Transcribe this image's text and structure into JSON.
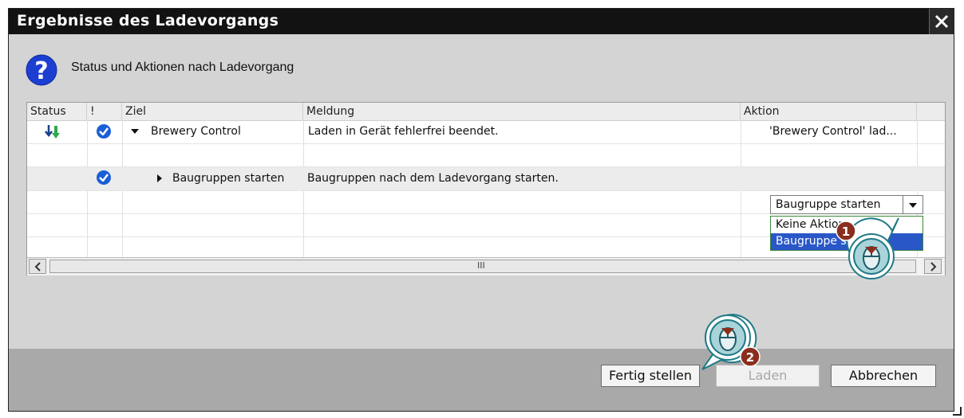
{
  "dialog": {
    "title": "Ergebnisse des Ladevorgangs",
    "header_text": "Status und Aktionen nach Ladevorgang"
  },
  "table": {
    "columns": [
      "Status",
      "!",
      "Ziel",
      "Meldung",
      "Aktion"
    ],
    "rows": [
      {
        "status_icon": "download-arrow-icon",
        "check_icon": "check-circle-icon",
        "expand": "expanded",
        "ziel": "Brewery Control",
        "meldung": "Laden in Gerät fehlerfrei beendet.",
        "aktion": "'Brewery Control' lad..."
      },
      {
        "check_icon": "check-circle-icon",
        "expand": "collapsed",
        "ziel": "Baugruppen starten",
        "meldung": "Baugruppen nach dem Ladevorgang starten.",
        "aktion_selected": "Baugruppe starten"
      }
    ],
    "scroll_grip": "III"
  },
  "dropdown": {
    "selected": "Baugruppe starten",
    "options": [
      "Keine Aktion",
      "Baugruppe starten"
    ],
    "highlighted_index": 1
  },
  "buttons": {
    "finish": "Fertig stellen",
    "load": "Laden",
    "cancel": "Abbrechen"
  },
  "callouts": [
    {
      "number": "1",
      "icon": "mouse-click-icon"
    },
    {
      "number": "2",
      "icon": "mouse-click-icon"
    }
  ],
  "colors": {
    "titlebar": "#121212",
    "check": "#1a5fd6",
    "highlight": "#2a57c8",
    "callout_badge": "#8a2e1e",
    "callout_fill": "#1f7a86"
  }
}
